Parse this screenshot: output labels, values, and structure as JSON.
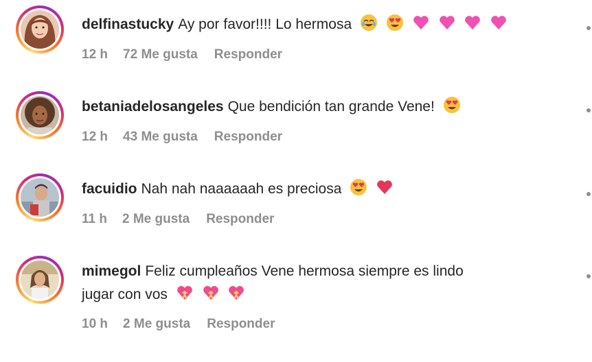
{
  "comments": [
    {
      "username": "delfinastucky",
      "text": "Ay por favor!!!! Lo hermosa",
      "text_line2": "",
      "emojis": [
        "crying-laughing-emoji",
        "heart-eyes-emoji",
        "pink-heart-emoji",
        "pink-heart-emoji",
        "pink-heart-emoji",
        "pink-heart-emoji"
      ],
      "time": "12 h",
      "likes": "72 Me gusta",
      "reply": "Responder"
    },
    {
      "username": "betaniadelosangeles",
      "text": "Que bendición tan grande Vene!",
      "text_line2": "",
      "emojis": [
        "heart-eyes-emoji"
      ],
      "time": "12 h",
      "likes": "43 Me gusta",
      "reply": "Responder"
    },
    {
      "username": "facuidio",
      "text": "Nah nah naaaaaah es preciosa",
      "text_line2": "",
      "emojis": [
        "heart-eyes-emoji",
        "red-heart-emoji"
      ],
      "time": "11 h",
      "likes": "2 Me gusta",
      "reply": "Responder"
    },
    {
      "username": "mimegol",
      "text": "Feliz cumpleaños Vene hermosa siempre es lindo",
      "text_line2": "jugar con vos",
      "emojis": [
        "heart-with-ribbon-emoji",
        "heart-with-ribbon-emoji",
        "heart-with-ribbon-emoji"
      ],
      "time": "10 h",
      "likes": "2 Me gusta",
      "reply": "Responder"
    }
  ],
  "colors": {
    "text": "#262626",
    "meta": "#8e8e8e",
    "story_ring": [
      "#feda75",
      "#fa7e1e",
      "#d62976",
      "#962fbf"
    ]
  }
}
